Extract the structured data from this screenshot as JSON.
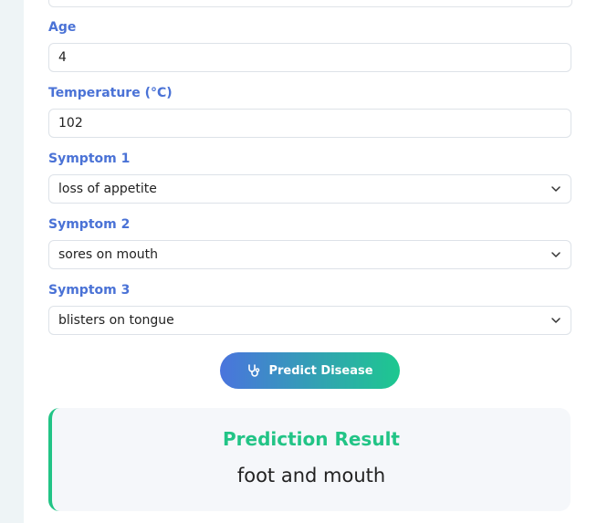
{
  "form": {
    "age": {
      "label": "Age",
      "value": "4"
    },
    "temperature": {
      "label": "Temperature (°C)",
      "value": "102"
    },
    "symptom1": {
      "label": "Symptom 1",
      "value": "loss of appetite"
    },
    "symptom2": {
      "label": "Symptom 2",
      "value": "sores on mouth"
    },
    "symptom3": {
      "label": "Symptom 3",
      "value": "blisters on tongue"
    }
  },
  "predict_button": {
    "label": "Predict Disease",
    "icon": "stethoscope-icon"
  },
  "result": {
    "title": "Prediction Result",
    "value": "foot and mouth"
  },
  "colors": {
    "label": "#4a72d6",
    "accent_green": "#22c486",
    "gradient_start": "#4a74dd",
    "gradient_end": "#1dc88f"
  }
}
